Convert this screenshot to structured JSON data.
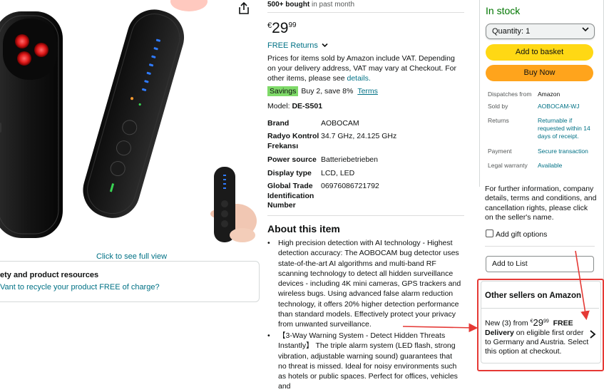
{
  "gallery": {
    "full_view_link": "Click to see full view"
  },
  "resources": {
    "title": "ety and product resources",
    "recycle_link": "Vant to recycle your product FREE of charge?"
  },
  "details": {
    "bought_count": "500+ bought",
    "bought_suffix": " in past month",
    "price": {
      "currency": "€",
      "whole": "29",
      "fraction": "99"
    },
    "free_returns": "FREE Returns",
    "vat_text": "Prices for items sold by Amazon include VAT. Depending on your delivery address, VAT may vary at Checkout. For other items, please see ",
    "vat_link": "details.",
    "savings_badge": "Savings",
    "savings_text": "Buy 2, save 8%",
    "savings_terms": "Terms",
    "model_label": "Model: ",
    "model_value": "DE-S501",
    "specs": [
      {
        "key": "Brand",
        "value": "AOBOCAM"
      },
      {
        "key": "Radyo Kontrol Frekansı",
        "value": "34.7 GHz, 24.125 GHz"
      },
      {
        "key": "Power source",
        "value": "Batteriebetrieben"
      },
      {
        "key": "Display type",
        "value": "LCD, LED"
      },
      {
        "key": "Global Trade Identification Number",
        "value": "06976086721792"
      }
    ],
    "about_title": "About this item",
    "bullets": [
      "High precision detection with AI technology - Highest detection accuracy: The AOBOCAM bug detector uses state-of-the-art AI algorithms and multi-band RF scanning technology to detect all hidden surveillance devices - including 4K mini cameras, GPS trackers and wireless bugs. Using advanced false alarm reduction technology, it offers 20% higher detection performance than standard models. Effectively protect your privacy from unwanted surveillance.",
      "【3-Way Warning System - Detect Hidden Threats Instantly】 The triple alarm system (LED flash, strong vibration, adjustable warning sound) guarantees that no threat is missed. Ideal for noisy environments such as hotels or public spaces. Perfect for offices, vehicles and"
    ]
  },
  "buybox": {
    "stock_status": "In stock",
    "quantity_label": "Quantity: 1",
    "add_to_basket": "Add to basket",
    "buy_now": "Buy Now",
    "info": [
      {
        "key": "Dispatches from",
        "value": "Amazon"
      },
      {
        "key": "Sold by",
        "value": "AOBOCAM-WJ"
      },
      {
        "key": "Returns",
        "value": "Returnable if requested within 14 days of receipt."
      },
      {
        "key": "Payment",
        "value": "Secure transaction"
      },
      {
        "key": "Legal warranty",
        "value": "Available"
      }
    ],
    "further_info": "For further information, company details, terms and conditions, and cancellation rights, please click on the seller's name.",
    "gift_options": "Add gift options",
    "add_to_list": "Add to List"
  },
  "other_sellers": {
    "title": "Other sellers on Amazon",
    "count_text": "New (3) from ",
    "price_currency": "€",
    "price_whole": "29",
    "price_fraction": "99",
    "free_label": "FREE",
    "delivery_text": "Delivery on eligible first order to Germany and Austria. Select this option at checkout."
  },
  "colors": {
    "link": "#007185",
    "in_stock": "#007600",
    "add_to_basket_bg": "#ffd814",
    "buy_now_bg": "#ffa41c",
    "savings_badge_bg": "#7fda69",
    "annotation_red": "#e53935"
  },
  "icons": [
    "share-icon",
    "chevron-down-icon",
    "chevron-right-icon",
    "checkbox-icon"
  ]
}
